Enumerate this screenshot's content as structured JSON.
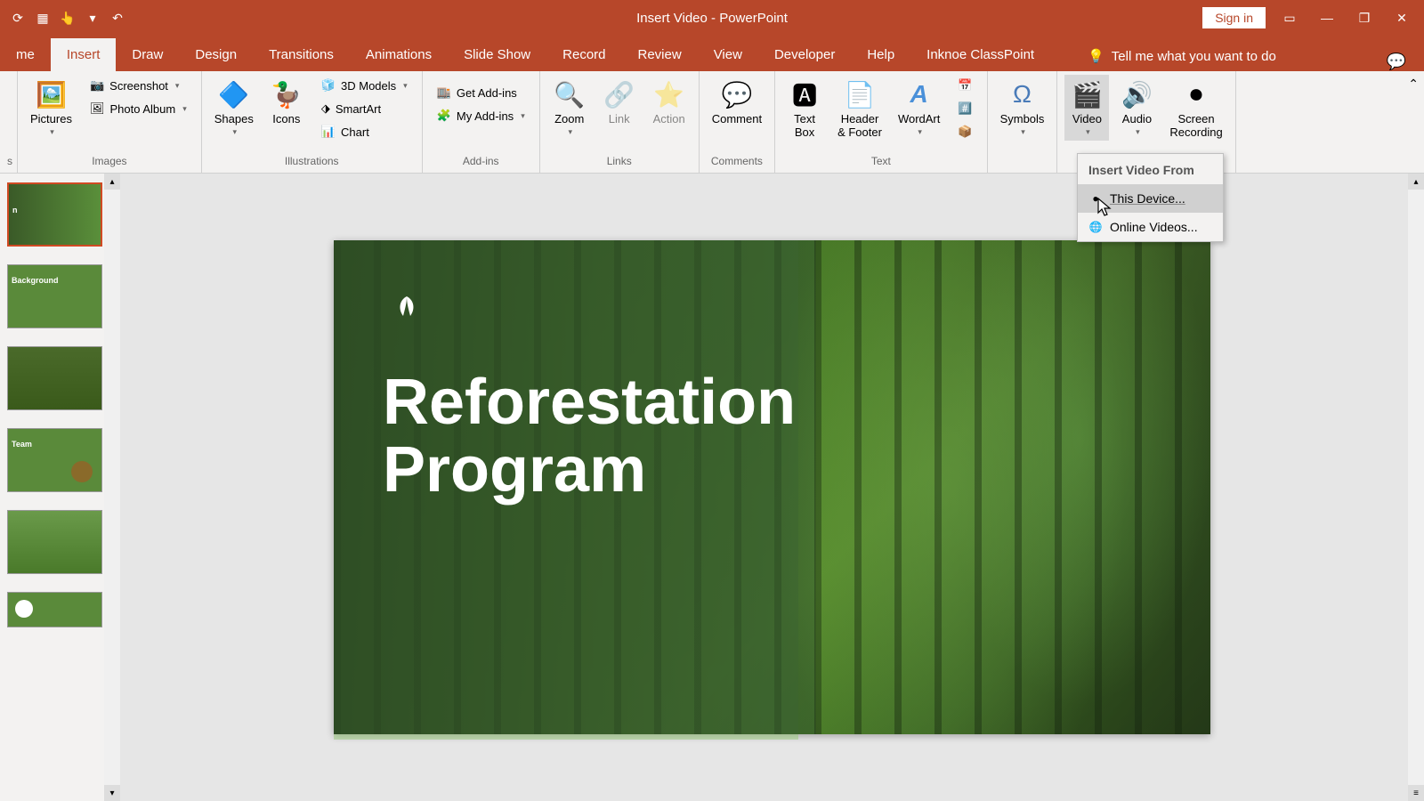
{
  "titlebar": {
    "title": "Insert Video  -  PowerPoint",
    "signin": "Sign in"
  },
  "tabs": {
    "home": "me",
    "insert": "Insert",
    "draw": "Draw",
    "design": "Design",
    "transitions": "Transitions",
    "animations": "Animations",
    "slideshow": "Slide Show",
    "record": "Record",
    "review": "Review",
    "view": "View",
    "developer": "Developer",
    "help": "Help",
    "classpoint": "Inknoe ClassPoint",
    "tellme": "Tell me what you want to do"
  },
  "ribbon": {
    "images": {
      "label": "Images",
      "pictures": "Pictures",
      "screenshot": "Screenshot",
      "photoalbum": "Photo Album"
    },
    "illustrations": {
      "label": "Illustrations",
      "shapes": "Shapes",
      "icons": "Icons",
      "models3d": "3D Models",
      "smartart": "SmartArt",
      "chart": "Chart"
    },
    "addins": {
      "label": "Add-ins",
      "get": "Get Add-ins",
      "my": "My Add-ins"
    },
    "links": {
      "label": "Links",
      "zoom": "Zoom",
      "link": "Link",
      "action": "Action"
    },
    "comments": {
      "label": "Comments",
      "comment": "Comment"
    },
    "text": {
      "label": "Text",
      "textbox": "Text\nBox",
      "headerfooter": "Header\n& Footer",
      "wordart": "WordArt"
    },
    "symbols": {
      "label": "",
      "symbols": "Symbols"
    },
    "media": {
      "label": "",
      "video": "Video",
      "audio": "Audio",
      "screenrec": "Screen\nRecording"
    }
  },
  "dropdown": {
    "header": "Insert Video From",
    "thisdevice": "This Device...",
    "online": "Online Videos..."
  },
  "slide": {
    "title": "Reforestation\nProgram"
  },
  "thumbs": {
    "t2": "Background",
    "t4": "Team"
  }
}
